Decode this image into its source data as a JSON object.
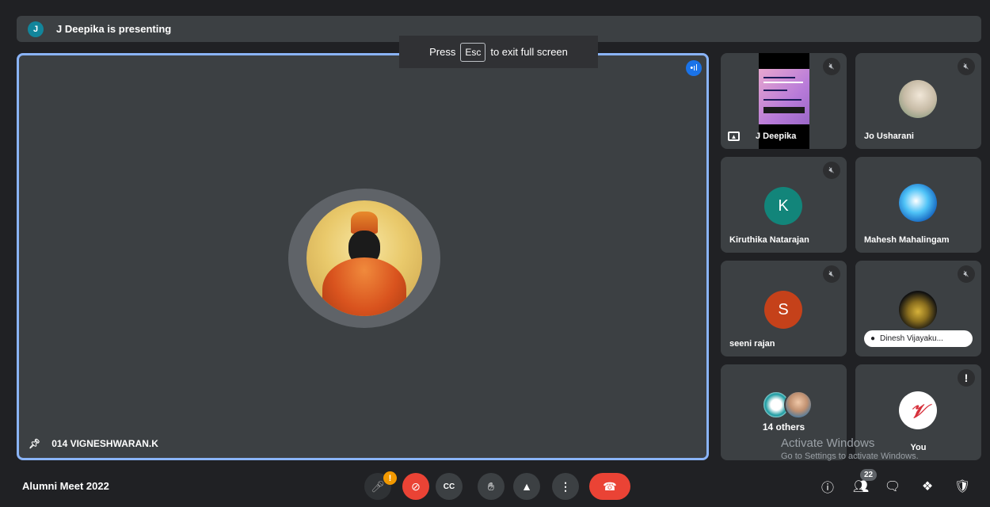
{
  "presenting_bar": {
    "avatar_letter": "J",
    "text": "J Deepika is presenting"
  },
  "fullscreen_toast": {
    "prefix": "Press",
    "key": "Esc",
    "suffix": "to exit full screen"
  },
  "main_tile": {
    "name": "014 VIGNESHWARAN.K"
  },
  "tiles": {
    "deepika": {
      "name": "J Deepika"
    },
    "usharani": {
      "name": "Jo Usharani"
    },
    "kiruthika": {
      "name": "Kiruthika Natarajan",
      "letter": "K",
      "color": "#12857a"
    },
    "mahesh": {
      "name": "Mahesh Mahalingam"
    },
    "seeni": {
      "name": "seeni rajan",
      "letter": "S",
      "color": "#c5411a"
    },
    "dinesh": {
      "name": "Dinesh Vijayaku..."
    },
    "others": {
      "label": "14 others"
    },
    "you": {
      "name": "You"
    }
  },
  "watermark": {
    "title": "Activate Windows",
    "subtitle": "Go to Settings to activate Windows."
  },
  "bottom_bar": {
    "meeting_title": "Alumni Meet 2022",
    "mic_warning": "!",
    "participant_count": "22",
    "icons": [
      "mic-icon",
      "camera-off-icon",
      "captions-icon",
      "raise-hand-icon",
      "present-icon",
      "more-options-icon",
      "hang-up-icon",
      "info-icon",
      "people-icon",
      "chat-icon",
      "activities-icon",
      "host-controls-icon"
    ]
  },
  "colors": {
    "accent": "#8ab4f8",
    "red": "#ea4335",
    "background": "#202124",
    "tile": "#3c4043"
  }
}
